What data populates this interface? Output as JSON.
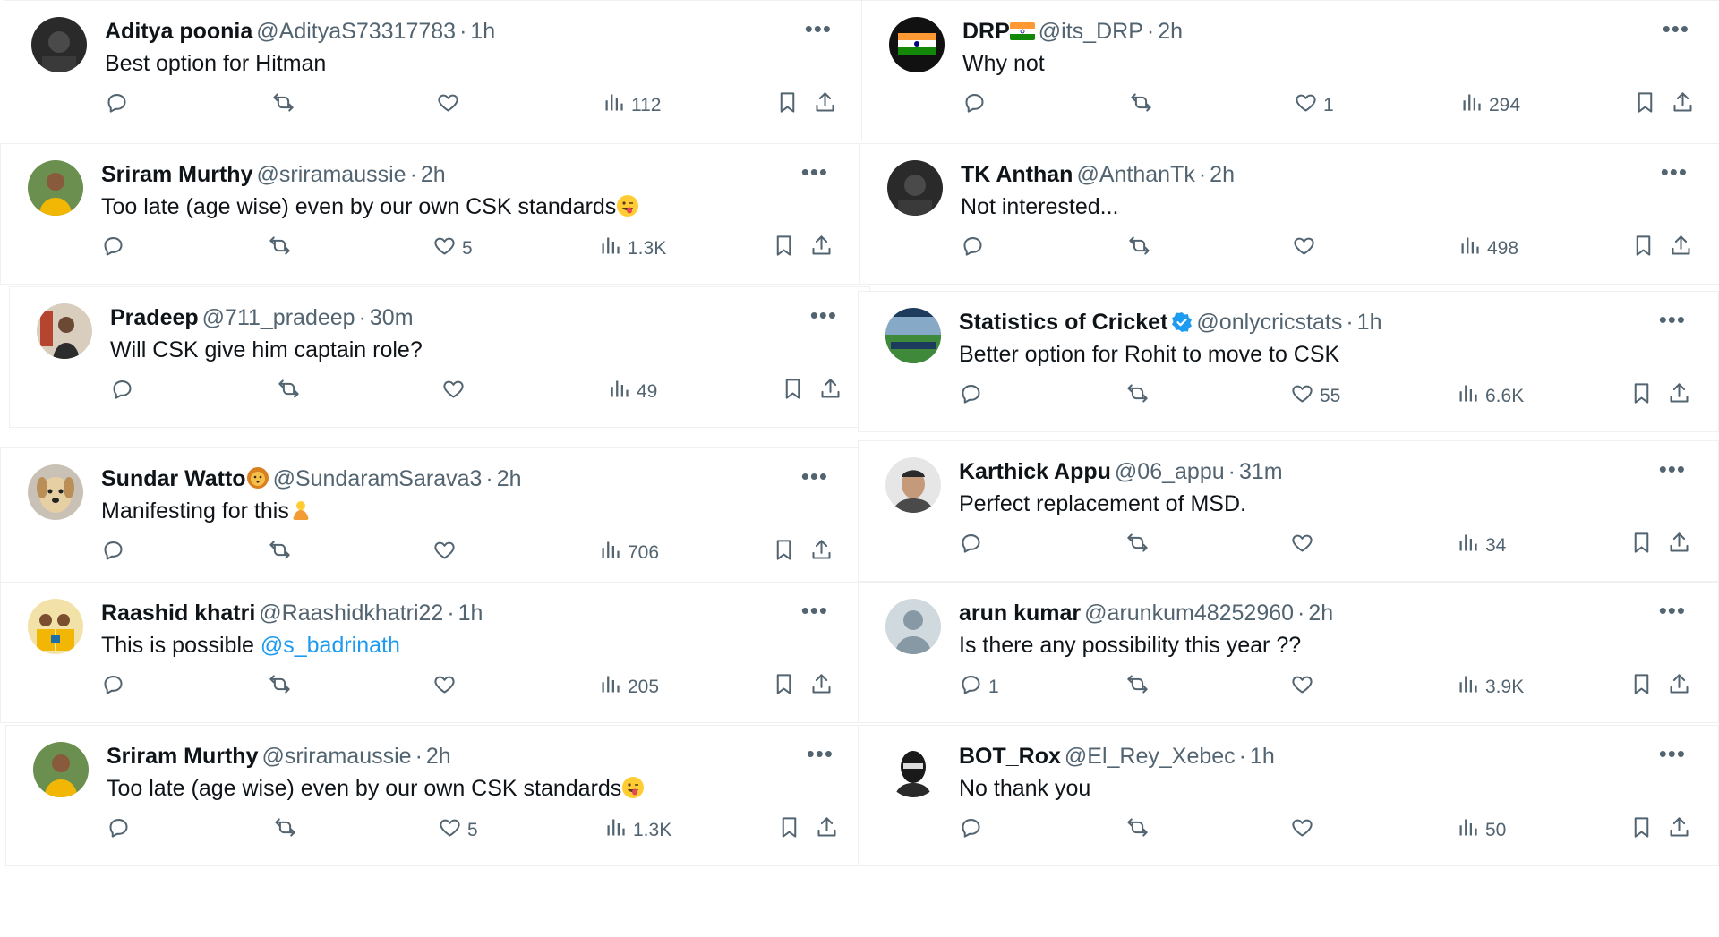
{
  "colors": {
    "text": "#0f1419",
    "muted": "#536471",
    "link": "#1d9bf0",
    "border": "#eef0f2",
    "verified": "#1d9bf0"
  },
  "left": [
    {
      "name": "Aditya poonia",
      "handle": "@AdityaS73317783",
      "time": "1h",
      "text": "Best option for Hitman",
      "replies": "",
      "retweets": "",
      "likes": "",
      "views": "112",
      "avatar": "dark-photo"
    },
    {
      "name": "Sriram Murthy",
      "handle": "@sriramaussie",
      "time": "2h",
      "text": "Too late (age wise) even by our own CSK standards",
      "emoji": "winking-tongue-emoji",
      "replies": "",
      "retweets": "",
      "likes": "5",
      "views": "1.3K",
      "avatar": "yellow-jersey-photo"
    },
    {
      "name": "Pradeep",
      "handle": "@711_pradeep",
      "time": "30m",
      "text": "Will CSK give him captain role?",
      "replies": "",
      "retweets": "",
      "likes": "",
      "views": "49",
      "avatar": "person-photo"
    },
    {
      "name": "Sundar Watto",
      "name_emoji": "lion-emoji",
      "handle": "@SundaramSarava3",
      "time": "2h",
      "text": "Manifesting for this",
      "emoji": "praying-person-emoji",
      "replies": "",
      "retweets": "",
      "likes": "",
      "views": "706",
      "avatar": "dog-photo"
    },
    {
      "name": "Raashid khatri",
      "handle": "@Raashidkhatri22",
      "time": "1h",
      "text": "This is possible ",
      "mention": "@s_badrinath",
      "replies": "",
      "retweets": "",
      "likes": "",
      "views": "205",
      "avatar": "team-photo"
    },
    {
      "name": "Sriram Murthy",
      "handle": "@sriramaussie",
      "time": "2h",
      "text": "Too late (age wise) even by our own CSK standards",
      "emoji": "winking-tongue-emoji",
      "replies": "",
      "retweets": "",
      "likes": "5",
      "views": "1.3K",
      "avatar": "yellow-jersey-photo"
    }
  ],
  "right": [
    {
      "name": "DRP",
      "name_emoji": "india-flag-emoji",
      "handle": "@its_DRP",
      "time": "2h",
      "text": "Why not",
      "replies": "",
      "retweets": "",
      "likes": "1",
      "views": "294",
      "avatar": "flag-photo"
    },
    {
      "name": "TK Anthan",
      "handle": "@AnthanTk",
      "time": "2h",
      "text": "Not interested...",
      "replies": "",
      "retweets": "",
      "likes": "",
      "views": "498",
      "avatar": "dark-photo"
    },
    {
      "name": "Statistics of Cricket",
      "verified": true,
      "handle": "@onlycricstats",
      "time": "1h",
      "text": "Better option for Rohit to move to CSK",
      "replies": "",
      "retweets": "",
      "likes": "55",
      "views": "6.6K",
      "avatar": "stadium-logo"
    },
    {
      "name": "Karthick Appu",
      "handle": "@06_appu",
      "time": "31m",
      "text": "Perfect replacement of MSD.",
      "replies": "",
      "retweets": "",
      "likes": "",
      "views": "34",
      "avatar": "face-photo"
    },
    {
      "name": "arun kumar",
      "handle": "@arunkum48252960",
      "time": "2h",
      "text": "Is there any possibility this year ??",
      "replies": "1",
      "retweets": "",
      "likes": "",
      "views": "3.9K",
      "avatar": "default-avatar"
    },
    {
      "name": "BOT_Rox",
      "handle": "@El_Rey_Xebec",
      "time": "1h",
      "text": "No thank you",
      "replies": "",
      "retweets": "",
      "likes": "",
      "views": "50",
      "avatar": "masked-photo"
    }
  ]
}
